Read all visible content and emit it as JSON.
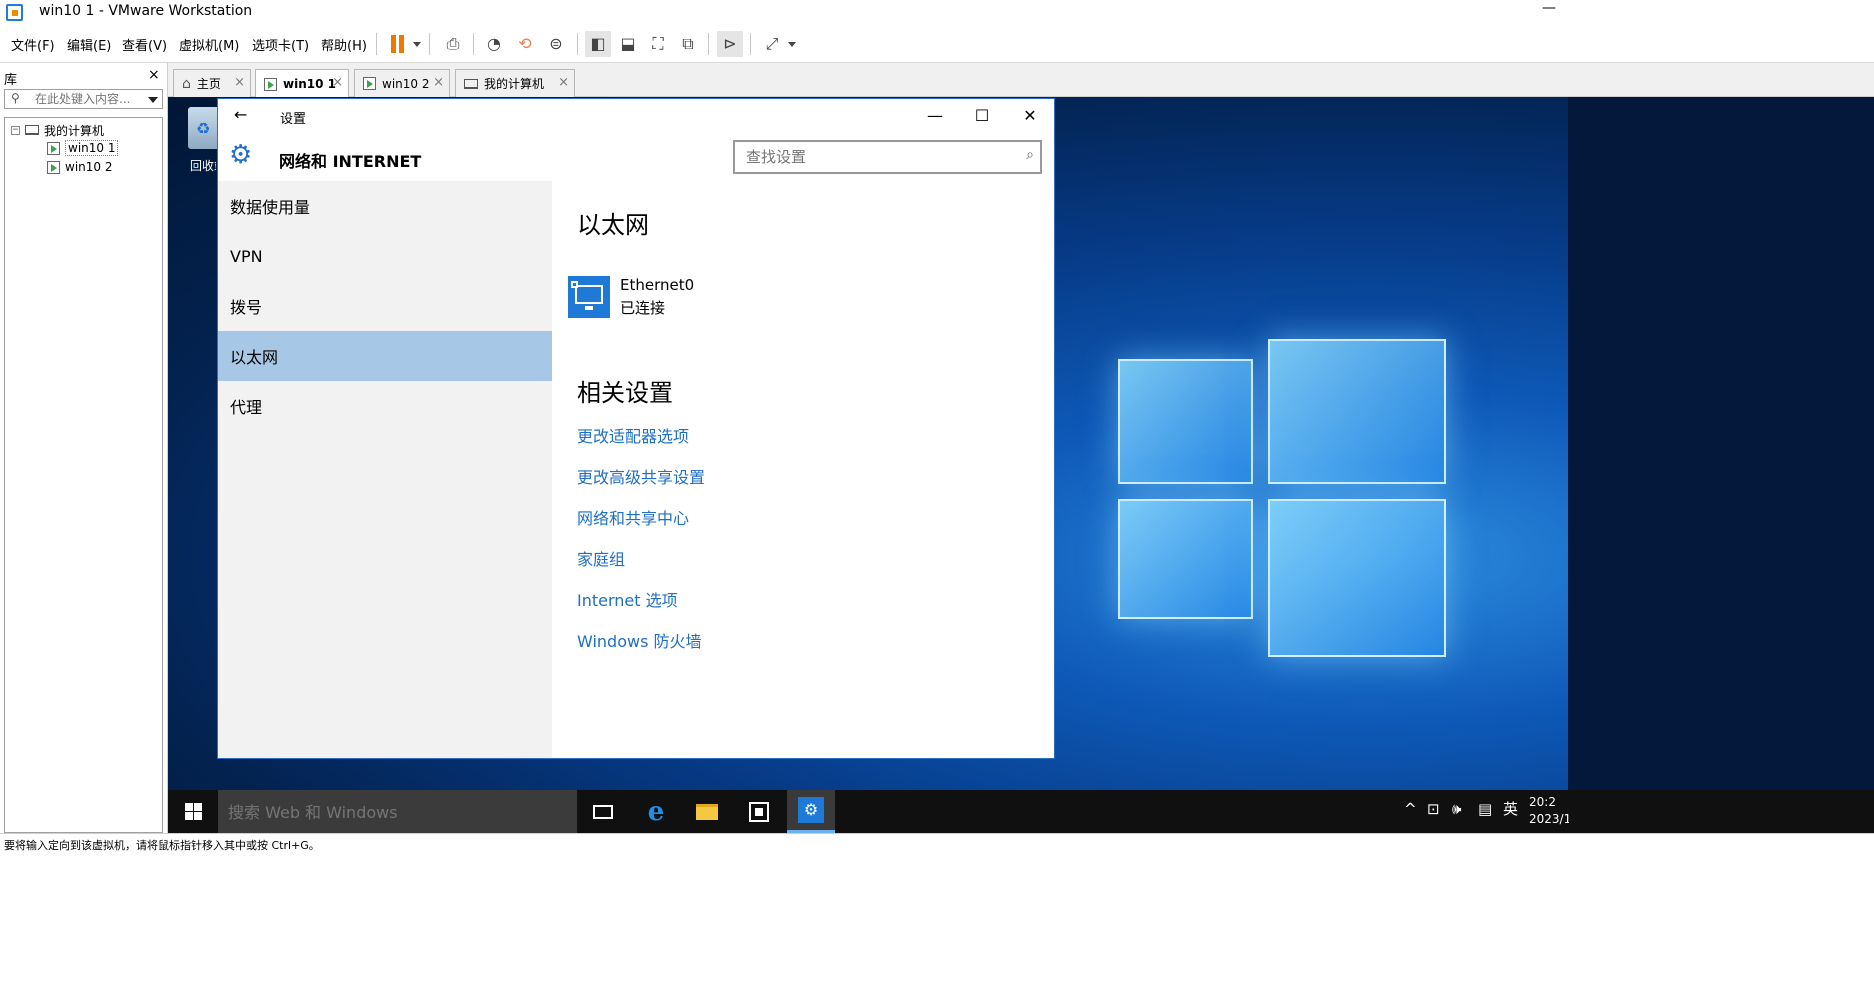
{
  "window": {
    "title": "win10 1 - VMware Workstation",
    "minimize_glyph": "—"
  },
  "menu": {
    "items": [
      "文件(F)",
      "编辑(E)",
      "查看(V)",
      "虚拟机(M)",
      "选项卡(T)",
      "帮助(H)"
    ]
  },
  "toolbar": {
    "icons": [
      "pause-icon",
      "send-ctrl-alt-del-icon",
      "snapshot-icon",
      "revert-snapshot-icon",
      "snapshot-manager-icon",
      "library-view-icon",
      "thumbnail-view-icon",
      "fullscreen-icon",
      "unity-icon",
      "console-view-icon",
      "stretch-icon"
    ]
  },
  "library": {
    "title": "库",
    "close": "×",
    "search_placeholder": "在此处键入内容...",
    "tree": {
      "root": "我的计算机",
      "root_expander": "−",
      "vms": [
        "win10 1",
        "win10 2"
      ]
    }
  },
  "tabs": [
    {
      "label": "主页",
      "icon": "home-icon"
    },
    {
      "label": "win10 1",
      "icon": "vm-icon",
      "active": true
    },
    {
      "label": "win10 2",
      "icon": "vm-icon"
    },
    {
      "label": "我的计算机",
      "icon": "monitor-icon"
    }
  ],
  "tab_close": "×",
  "desktop": {
    "recycle_bin_label": "回收站",
    "recycle_glyph": "♻"
  },
  "settings": {
    "back": "←",
    "title": "设置",
    "minimize": "—",
    "maximize": "☐",
    "close": "✕",
    "gear": "⚙",
    "section": "网络和 INTERNET",
    "search_placeholder": "查找设置",
    "search_glyph": "⌕",
    "nav": [
      "数据使用量",
      "VPN",
      "拨号",
      "以太网",
      "代理"
    ],
    "nav_active_index": 3,
    "heading": "以太网",
    "adapter": {
      "name": "Ethernet0",
      "status": "已连接"
    },
    "related_heading": "相关设置",
    "related_links": [
      "更改适配器选项",
      "更改高级共享设置",
      "网络和共享中心",
      "家庭组",
      "Internet 选项",
      "Windows 防火墙"
    ]
  },
  "taskbar": {
    "search_placeholder": "搜索 Web 和 Windows",
    "edge_glyph": "e",
    "settings_glyph": "⚙",
    "tray": {
      "chevron": "^",
      "network": "⊡",
      "volume": "🕪",
      "notifications": "▤",
      "ime": "英"
    },
    "clock_time": "20:2",
    "clock_date": "2023/1"
  },
  "status": {
    "text": "要将输入定向到该虚拟机，请将鼠标指针移入其中或按 Ctrl+G。"
  },
  "colors": {
    "accent": "#1e7ad6",
    "nav_active": "#a6c8e6",
    "link": "#1f6fc4",
    "pause": "#f07800"
  }
}
